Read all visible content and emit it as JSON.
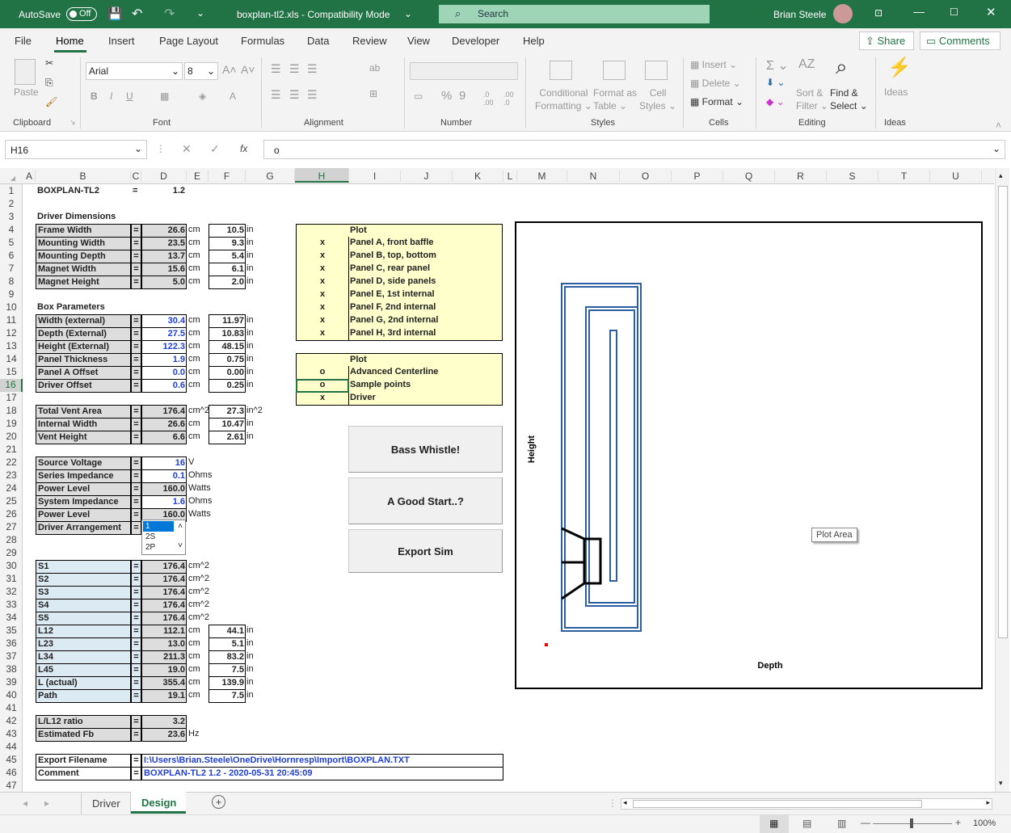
{
  "title": {
    "autosave": "AutoSave",
    "toggle": "Off",
    "file": "boxplan-tl2.xls  -  Compatibility Mode",
    "search": "Search",
    "user": "Brian Steele"
  },
  "menu": {
    "file": "File",
    "home": "Home",
    "insert": "Insert",
    "layout": "Page Layout",
    "formulas": "Formulas",
    "data": "Data",
    "review": "Review",
    "view": "View",
    "developer": "Developer",
    "help": "Help",
    "share": "Share",
    "comments": "Comments"
  },
  "ribbon": {
    "paste": "Paste",
    "font": "Arial",
    "size": "8",
    "clipboard": "Clipboard",
    "font_grp": "Font",
    "alignment": "Alignment",
    "number": "Number",
    "cond1": "Conditional",
    "cond2": "Formatting",
    "fmt1": "Format as",
    "fmt2": "Table",
    "cs1": "Cell",
    "cs2": "Styles",
    "styles": "Styles",
    "ins": "Insert",
    "del": "Delete",
    "format": "Format",
    "cells": "Cells",
    "sort1": "Sort &",
    "sort2": "Filter",
    "find1": "Find &",
    "find2": "Select",
    "editing": "Editing",
    "ideas": "Ideas",
    "ideas_grp": "Ideas"
  },
  "formula": {
    "ref": "H16",
    "value": "o"
  },
  "cols": [
    "A",
    "B",
    "C",
    "D",
    "E",
    "F",
    "G",
    "H",
    "I",
    "J",
    "K",
    "L",
    "M",
    "N",
    "O",
    "P",
    "Q",
    "R",
    "S",
    "T",
    "U"
  ],
  "rows": [
    "1",
    "2",
    "3",
    "4",
    "5",
    "6",
    "7",
    "8",
    "9",
    "10",
    "11",
    "12",
    "13",
    "14",
    "15",
    "16",
    "17",
    "18",
    "19",
    "20",
    "21",
    "22",
    "23",
    "24",
    "25",
    "26",
    "27",
    "28",
    "29",
    "30",
    "31",
    "32",
    "33",
    "34",
    "35",
    "36",
    "37",
    "38",
    "39",
    "40",
    "41",
    "42",
    "43",
    "44",
    "45",
    "46",
    "47"
  ],
  "sheet": {
    "title": "BOXPLAN-TL2",
    "title_eq": "=",
    "version": "1.2",
    "driver_dims": "Driver Dimensions",
    "dd": [
      {
        "l": "Frame Width",
        "v": "26.6",
        "u": "cm",
        "i": "10.5",
        "iu": "in"
      },
      {
        "l": "Mounting Width",
        "v": "23.5",
        "u": "cm",
        "i": "9.3",
        "iu": "in"
      },
      {
        "l": "Mounting Depth",
        "v": "13.7",
        "u": "cm",
        "i": "5.4",
        "iu": "in"
      },
      {
        "l": "Magnet Width",
        "v": "15.6",
        "u": "cm",
        "i": "6.1",
        "iu": "in"
      },
      {
        "l": "Magnet Height",
        "v": "5.0",
        "u": "cm",
        "i": "2.0",
        "iu": "in"
      }
    ],
    "box_params": "Box Parameters",
    "bp": [
      {
        "l": "Width (external)",
        "v": "30.4",
        "u": "cm",
        "i": "11.97",
        "iu": "in"
      },
      {
        "l": "Depth (External)",
        "v": "27.5",
        "u": "cm",
        "i": "10.83",
        "iu": "in"
      },
      {
        "l": "Height (External)",
        "v": "122.3",
        "u": "cm",
        "i": "48.15",
        "iu": "in"
      },
      {
        "l": "Panel Thickness",
        "v": "1.9",
        "u": "cm",
        "i": "0.75",
        "iu": "in"
      },
      {
        "l": "Panel A Offset",
        "v": "0.0",
        "u": "cm",
        "i": "0.00",
        "iu": "in"
      },
      {
        "l": "Driver Offset",
        "v": "0.6",
        "u": "cm",
        "i": "0.25",
        "iu": "in"
      }
    ],
    "vent": [
      {
        "l": "Total Vent Area",
        "v": "176.4",
        "u": "cm^2",
        "i": "27.3",
        "iu": "in^2"
      },
      {
        "l": "Internal Width",
        "v": "26.6",
        "u": "cm",
        "i": "10.47",
        "iu": "in"
      },
      {
        "l": "Vent Height",
        "v": "6.6",
        "u": "cm",
        "i": "2.61",
        "iu": "in"
      }
    ],
    "elec": [
      {
        "l": "Source Voltage",
        "v": "16",
        "u": "V"
      },
      {
        "l": "Series Impedance",
        "v": "0.1",
        "u": "Ohms"
      },
      {
        "l": "Power Level",
        "v": "160.0",
        "u": "Watts"
      },
      {
        "l": "System Impedance",
        "v": "1.6",
        "u": "Ohms"
      },
      {
        "l": "Power Level",
        "v": "160.0",
        "u": "Watts"
      },
      {
        "l": "Driver Arrangement",
        "v": "",
        "u": ""
      }
    ],
    "arr_opts": [
      "1",
      "2S",
      "2P"
    ],
    "s": [
      {
        "l": "S1",
        "v": "176.4",
        "u": "cm^2"
      },
      {
        "l": "S2",
        "v": "176.4",
        "u": "cm^2"
      },
      {
        "l": "S3",
        "v": "176.4",
        "u": "cm^2"
      },
      {
        "l": "S4",
        "v": "176.4",
        "u": "cm^2"
      },
      {
        "l": "S5",
        "v": "176.4",
        "u": "cm^2"
      }
    ],
    "len": [
      {
        "l": "L12",
        "v": "112.1",
        "u": "cm",
        "i": "44.1",
        "iu": "in"
      },
      {
        "l": "L23",
        "v": "13.0",
        "u": "cm",
        "i": "5.1",
        "iu": "in"
      },
      {
        "l": "L34",
        "v": "211.3",
        "u": "cm",
        "i": "83.2",
        "iu": "in"
      },
      {
        "l": "L45",
        "v": "19.0",
        "u": "cm",
        "i": "7.5",
        "iu": "in"
      },
      {
        "l": "L (actual)",
        "v": "355.4",
        "u": "cm",
        "i": "139.9",
        "iu": "in"
      },
      {
        "l": "Path",
        "v": "19.1",
        "u": "cm",
        "i": "7.5",
        "iu": "in"
      }
    ],
    "ratio": [
      {
        "l": "L/L12 ratio",
        "v": "3.2",
        "u": ""
      },
      {
        "l": "Estimated Fb",
        "v": "23.6",
        "u": "Hz"
      }
    ],
    "export_l": "Export Filename",
    "export_v": "I:\\Users\\Brian.Steele\\OneDrive\\Hornresp\\Import\\BOXPLAN.TXT",
    "comment_l": "Comment",
    "comment_v": "BOXPLAN-TL2 1.2 - 2020-05-31 20:45:09",
    "eq": "=",
    "plot1_h": "Plot",
    "plot1": [
      {
        "m": "x",
        "l": "Panel A, front baffle"
      },
      {
        "m": "x",
        "l": "Panel B, top, bottom"
      },
      {
        "m": "x",
        "l": "Panel C, rear panel"
      },
      {
        "m": "x",
        "l": "Panel D, side panels"
      },
      {
        "m": "x",
        "l": "Panel E, 1st internal"
      },
      {
        "m": "x",
        "l": "Panel F, 2nd internal"
      },
      {
        "m": "x",
        "l": "Panel G, 2nd internal"
      },
      {
        "m": "x",
        "l": "Panel H, 3rd internal"
      }
    ],
    "plot2_h": "Plot",
    "plot2": [
      {
        "m": "o",
        "l": "Advanced Centerline"
      },
      {
        "m": "o",
        "l": "Sample points"
      },
      {
        "m": "x",
        "l": "Driver"
      }
    ],
    "btn1": "Bass Whistle!",
    "btn2": "A Good Start..?",
    "btn3": "Export Sim",
    "chart_height": "Height",
    "chart_depth": "Depth",
    "plot_area": "Plot Area"
  },
  "tabs": {
    "driver": "Driver",
    "design": "Design"
  },
  "zoom": "100%",
  "colors": {
    "accent": "#217346",
    "blue_val": "#1f3fd6",
    "panel": "#2d5fa0"
  }
}
